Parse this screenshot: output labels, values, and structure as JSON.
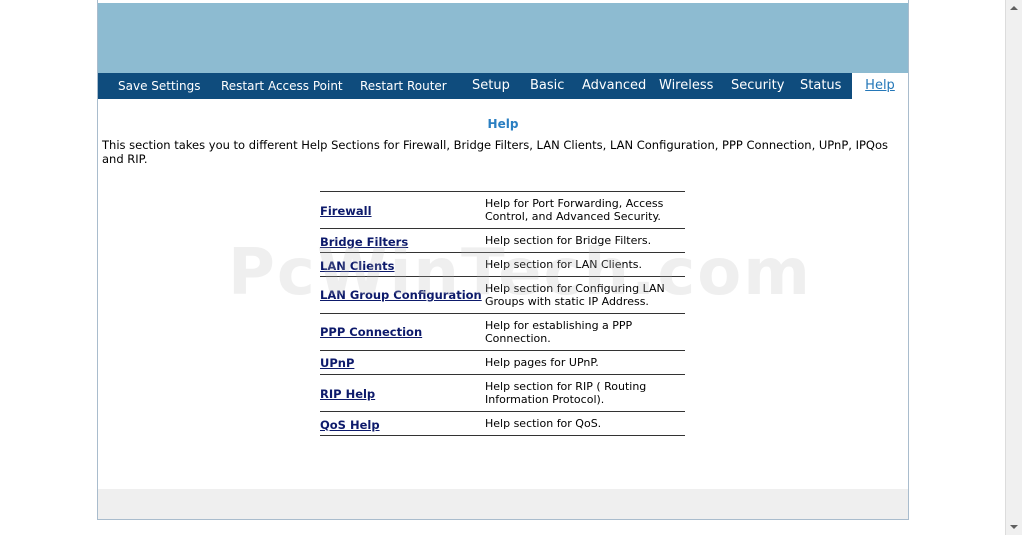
{
  "nav": {
    "save_settings": "Save Settings",
    "restart_ap": "Restart Access Point",
    "restart_router": "Restart Router",
    "setup": "Setup",
    "basic": "Basic",
    "advanced": "Advanced",
    "wireless": "Wireless",
    "security": "Security",
    "status": "Status",
    "help": "Help"
  },
  "page": {
    "title": "Help",
    "intro": "This section takes you to different Help Sections for Firewall, Bridge Filters, LAN Clients, LAN Configuration, PPP Connection, UPnP, IPQos and RIP."
  },
  "help_rows": [
    {
      "link": "Firewall",
      "desc": "Help for Port Forwarding, Access Control, and Advanced Security."
    },
    {
      "link": "Bridge Filters",
      "desc": "Help section for Bridge Filters."
    },
    {
      "link": "LAN Clients",
      "desc": "Help section for LAN Clients."
    },
    {
      "link": "LAN Group Configuration",
      "desc": "Help section for Configuring LAN Groups with static IP Address."
    },
    {
      "link": "PPP Connection",
      "desc": "Help for establishing a PPP Connection."
    },
    {
      "link": "UPnP",
      "desc": "Help pages for UPnP."
    },
    {
      "link": "RIP Help",
      "desc": "Help section for RIP ( Routing Information Protocol)."
    },
    {
      "link": "QoS Help",
      "desc": "Help section for QoS."
    }
  ],
  "watermark": "PcWinTech.com",
  "colors": {
    "banner": "#8dbbd1",
    "nav_bg": "#0f4c7d",
    "title": "#2a7fc2",
    "link": "#0d1a6b"
  }
}
